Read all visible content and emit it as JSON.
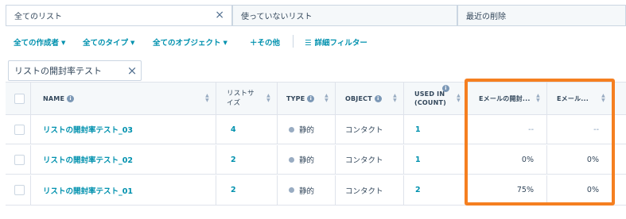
{
  "tabs": [
    {
      "label": "全てのリスト"
    },
    {
      "label": "使っていないリスト"
    },
    {
      "label": "最近の削除"
    }
  ],
  "filters": {
    "creator": "全ての作成者",
    "type": "全てのタイプ",
    "object": "全てのオブジェクト",
    "more": "＋その他",
    "advanced": "詳細フィルター"
  },
  "search": {
    "value": "リストの開封率テスト"
  },
  "table": {
    "headers": {
      "name": "NAME",
      "list_size": "リストサイズ",
      "type": "TYPE",
      "object": "OBJECT",
      "used_in": "USED IN (COUNT)",
      "open_rate": "Eメールの開封...",
      "email2": "Eメール..."
    },
    "rows": [
      {
        "name": "リストの開封率テスト_03",
        "size": "4",
        "type": "静的",
        "object": "コンタクト",
        "used": "1",
        "open_rate": "--",
        "email2": "--"
      },
      {
        "name": "リストの開封率テスト_02",
        "size": "2",
        "type": "静的",
        "object": "コンタクト",
        "used": "1",
        "open_rate": "0%",
        "email2": "0%"
      },
      {
        "name": "リストの開封率テスト_01",
        "size": "2",
        "type": "静的",
        "object": "コンタクト",
        "used": "2",
        "open_rate": "75%",
        "email2": "0%"
      }
    ]
  },
  "colors": {
    "accent": "#0091ae",
    "highlight": "#f57f20",
    "header_bg": "#f5f8fa"
  }
}
